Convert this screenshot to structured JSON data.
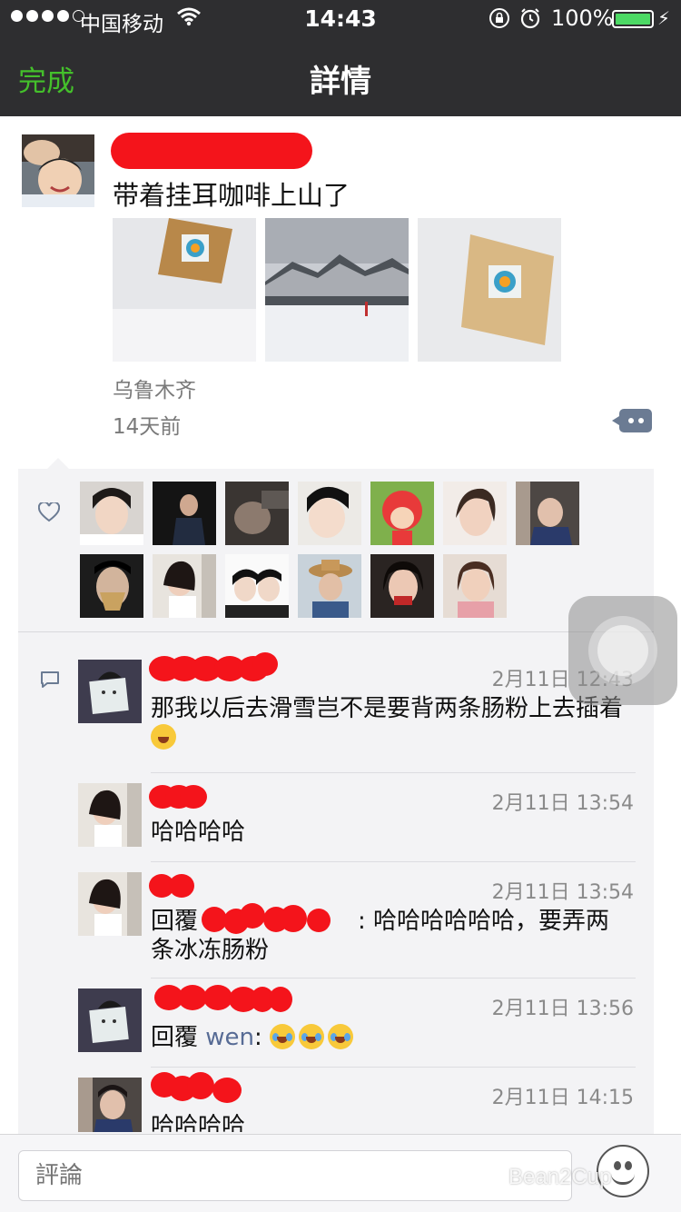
{
  "status_bar": {
    "carrier": "中国移动",
    "time": "14:43",
    "battery": "100%",
    "battery_level_percent": 100
  },
  "nav": {
    "done_label": "完成",
    "title": "詳情"
  },
  "post": {
    "text": "带着挂耳咖啡上山了",
    "location": "乌鲁木齐",
    "time_ago": "14天前",
    "images": [
      "coffee-drip-bag-in-snow",
      "snowy-mountain-landscape",
      "coffee-drip-bag-closeup"
    ]
  },
  "likes": {
    "count_shown": 13
  },
  "comments": [
    {
      "time": "2月11日 12:43",
      "text": "那我以后去滑雪岂不是要背两条肠粉上去插着",
      "emoji": "thinking-emoji"
    },
    {
      "time": "2月11日 13:54",
      "text": "哈哈哈哈"
    },
    {
      "time": "2月11日 13:54",
      "reply_prefix": "回覆",
      "text": ": 哈哈哈哈哈哈，要弄两条冰冻肠粉"
    },
    {
      "time": "2月11日 13:56",
      "reply_prefix": "回覆",
      "reply_name": "wen",
      "text": ":",
      "emoji": "crying-laughing-emoji"
    },
    {
      "time": "2月11日 14:15",
      "text": "哈哈哈哈"
    }
  ],
  "input": {
    "placeholder": "評論"
  },
  "watermark": "Bean2Cup",
  "colors": {
    "bar": "#2e2e30",
    "accent_green": "#44c02b",
    "link_blue": "#576b95",
    "redaction": "#f4141b"
  }
}
